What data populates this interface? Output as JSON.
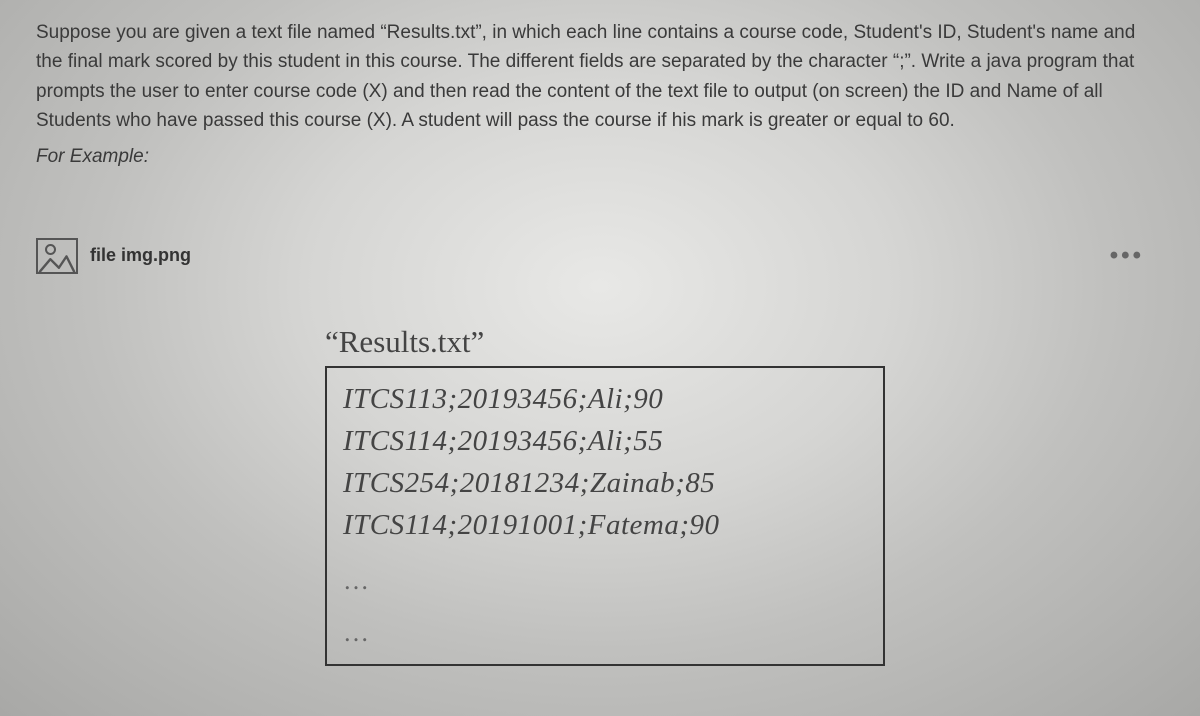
{
  "question": {
    "body": "Suppose you are given a text file named “Results.txt”, in which each line contains a course code, Student's ID, Student's name and the final mark scored by this student in this course. The different fields are separated by the character “;”. Write a java program that prompts the user to enter course code (X) and then read the content of the text file to output (on screen) the ID and Name of all Students who have passed this course (X). A student will pass the course if his mark is greater or equal to 60.",
    "for_example": "For Example:"
  },
  "attachment": {
    "filename": "file img.png",
    "more": "•••"
  },
  "file_preview": {
    "title": "“Results.txt”",
    "lines": [
      "ITCS113;20193456;Ali;90",
      "ITCS114;20193456;Ali;55",
      "ITCS254;20181234;Zainab;85",
      "ITCS114;20191001;Fatema;90"
    ],
    "ellipsis1": "…",
    "ellipsis2": "…"
  }
}
